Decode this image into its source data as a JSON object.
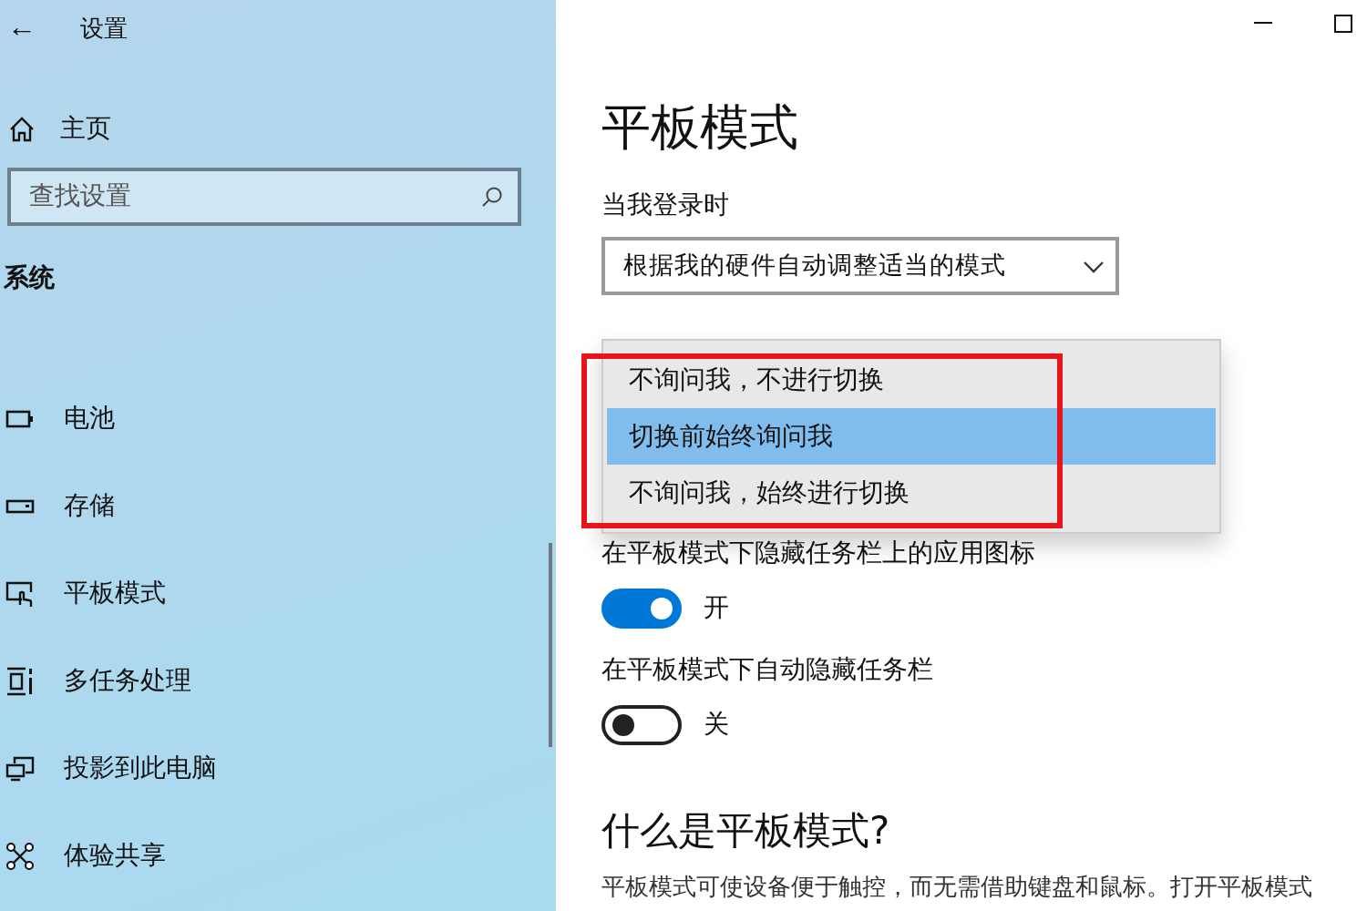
{
  "window": {
    "title": "设置",
    "back": "←"
  },
  "sidebar": {
    "home": "主页",
    "search": {
      "placeholder": "查找设置"
    },
    "section": "系统",
    "items": [
      {
        "label": "电池",
        "kind": "battery"
      },
      {
        "label": "存储",
        "kind": "storage"
      },
      {
        "label": "平板模式",
        "kind": "tablet"
      },
      {
        "label": "多任务处理",
        "kind": "multitask"
      },
      {
        "label": "投影到此电脑",
        "kind": "project"
      },
      {
        "label": "体验共享",
        "kind": "share"
      }
    ]
  },
  "page": {
    "title": "平板模式",
    "signin_label": "当我登录时",
    "signin_select": "根据我的硬件自动调整适当的模式",
    "dropdown": [
      {
        "label": "不询问我，不进行切换",
        "selected": false
      },
      {
        "label": "切换前始终询问我",
        "selected": true
      },
      {
        "label": "不询问我，始终进行切换",
        "selected": false
      }
    ],
    "toggles": [
      {
        "label": "在平板模式下隐藏任务栏上的应用图标",
        "on": true,
        "state": "开"
      },
      {
        "label": "在平板模式下自动隐藏任务栏",
        "on": false,
        "state": "关"
      }
    ],
    "section_title": "什么是平板模式?",
    "description": "平板模式可使设备便于触控，而无需借助键盘和鼠标。打开平板模式"
  }
}
